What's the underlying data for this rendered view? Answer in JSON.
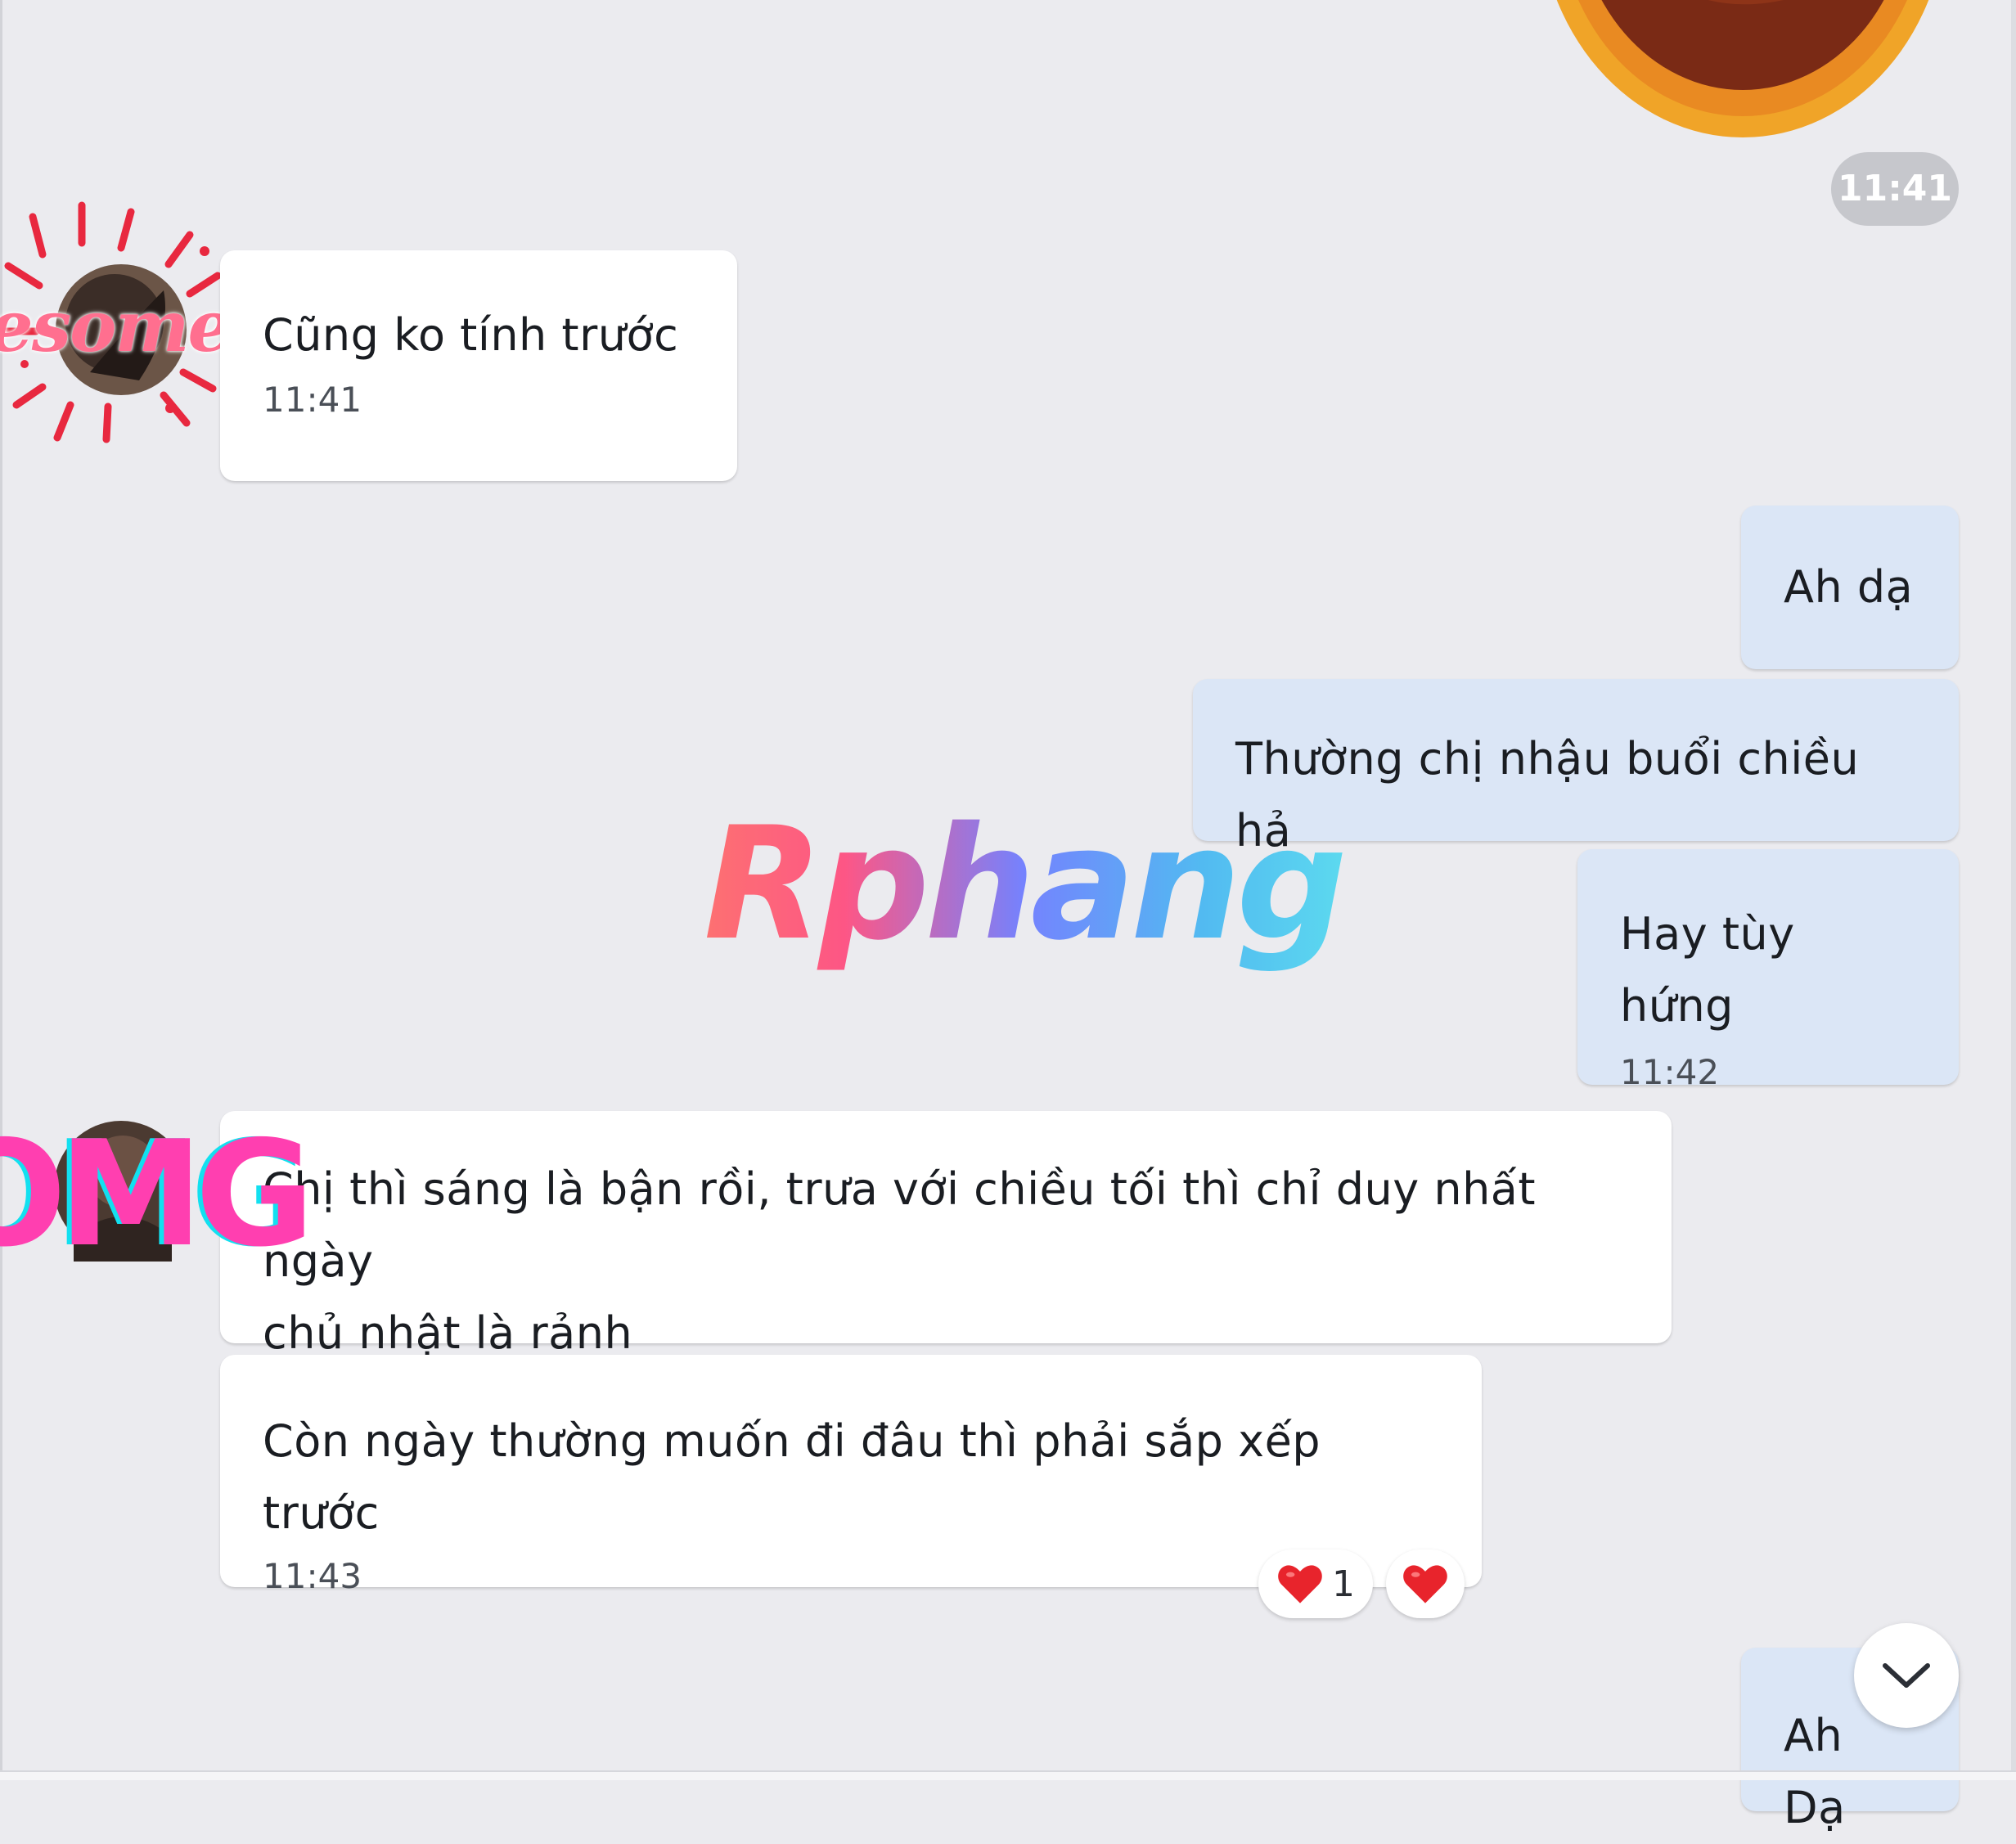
{
  "colors": {
    "background": "#ebebef",
    "incoming_bubble": "#ffffff",
    "outgoing_bubble": "#dbe6f6",
    "reaction_heart": "#e8242c"
  },
  "time_separator": "11:41",
  "messages": [
    {
      "direction": "incoming",
      "text": "Cũng ko tính trước",
      "time": "11:41"
    },
    {
      "direction": "outgoing",
      "text": "Ah dạ"
    },
    {
      "direction": "outgoing",
      "text": "Thường chị nhậu buổi chiều hả"
    },
    {
      "direction": "outgoing",
      "text": "Hay tùy hứng",
      "time": "11:42"
    },
    {
      "direction": "incoming",
      "text_line1": "Chị thì sáng là bận rồi, trưa với chiều tối thì chỉ duy nhất ngày",
      "text_line2": "chủ nhật là rảnh"
    },
    {
      "direction": "incoming",
      "text": "Còn ngày thường muốn đi đâu thì phải sắp xếp trước",
      "time": "11:43"
    },
    {
      "direction": "outgoing",
      "text": "Ah Dạ"
    }
  ],
  "avatar_frames": [
    {
      "icon": "awesome-frame",
      "text": "esome"
    },
    {
      "icon": "omg-frame",
      "text": "OMG"
    }
  ],
  "reactions": {
    "summary_icon": "heart-icon",
    "count": "1",
    "add_icon": "heart-icon"
  },
  "watermark": "Rphang",
  "scroll_down_icon": "chevron-down-icon"
}
